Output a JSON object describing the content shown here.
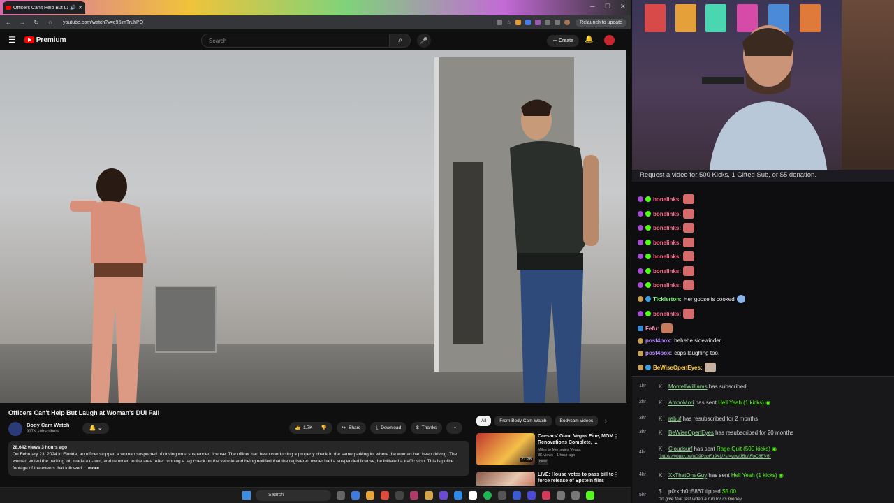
{
  "browser": {
    "tab_title": "Officers Can't Help But Lau",
    "url": "youtube.com/watch?v=e96lmTruhPQ",
    "relaunch_label": "Relaunch to update"
  },
  "youtube": {
    "logo_text": "Premium",
    "search_placeholder": "Search",
    "create_label": "Create"
  },
  "video": {
    "title": "Officers Can't Help But Laugh at Woman's DUI Fail",
    "channel": "Body Cam Watch",
    "subscribers": "917K subscribers",
    "likes": "1.7K",
    "share_label": "Share",
    "download_label": "Download",
    "thanks_label": "Thanks",
    "stats": "28,642 views  3 hours ago",
    "description": "On February 23, 2024 in Florida, an officer stopped a woman suspected of driving on a suspended license. The officer had been conducting a property check in the same parking lot where the woman had been driving. The woman exited the parking lot, made a u-turn, and returned to the area. After running a tag check on the vehicle and being notified that the registered owner had a suspended license, he initiated a traffic stop. This is police footage of the events that followed.",
    "more_label": "...more"
  },
  "chips": [
    "All",
    "From Body Cam Watch",
    "Bodycam videos"
  ],
  "recommendations": [
    {
      "title": "Caesars' Giant Vegas Fine, MGM Renovations Complete, ...",
      "channel": "Miles to Memories Vegas",
      "meta": "3K views · 1 hour ago",
      "badge": "New",
      "duration": "21:28"
    },
    {
      "title": "LIVE: House votes to pass bill to force release of Epstein files",
      "channel": "",
      "meta": "",
      "badge": "",
      "duration": ""
    }
  ],
  "taskbar": {
    "search_label": "Search"
  },
  "stream": {
    "request_banner": "Request a video for 500 Kicks, 1 Gifted Sub, or $5 donation."
  },
  "chat": [
    {
      "user": "bonelinks:",
      "text": "",
      "color": "#ff6b8a"
    },
    {
      "user": "bonelinks:",
      "text": "",
      "color": "#ff6b8a"
    },
    {
      "user": "bonelinks:",
      "text": "",
      "color": "#ff6b8a"
    },
    {
      "user": "bonelinks:",
      "text": "",
      "color": "#ff6b8a"
    },
    {
      "user": "bonelinks:",
      "text": "",
      "color": "#ff6b8a"
    },
    {
      "user": "bonelinks:",
      "text": "",
      "color": "#ff6b8a"
    },
    {
      "user": "bonelinks:",
      "text": "",
      "color": "#ff6b8a"
    },
    {
      "user": "Ticklerton:",
      "text": "Her goose is cooked",
      "color": "#7cfc7c"
    },
    {
      "user": "bonelinks:",
      "text": "",
      "color": "#ff6b8a"
    },
    {
      "user": "Fefu:",
      "text": "",
      "color": "#ff8fb8"
    },
    {
      "user": "post4pox:",
      "text": "hehehe sidewinder...",
      "color": "#b48aff"
    },
    {
      "user": "post4pox:",
      "text": "cops laughing too.",
      "color": "#b48aff"
    },
    {
      "user": "BeWiseOpenEyes:",
      "text": "",
      "color": "#ffcc33"
    }
  ],
  "events": [
    {
      "time": "1hr",
      "user": "MontellWilliams",
      "text": " has subscribed",
      "extra": "",
      "sub": ""
    },
    {
      "time": "2hr",
      "user": "AmooMori",
      "text": " has sent ",
      "extra": "Hell Yeah (1 kicks)",
      "sub": ""
    },
    {
      "time": "3hr",
      "user": "rabuf",
      "text": " has resubscribed for 2 months",
      "extra": "",
      "sub": ""
    },
    {
      "time": "3hr",
      "user": "BeWiseOpenEyes",
      "text": " has resubscribed for 20 months",
      "extra": "",
      "sub": ""
    },
    {
      "time": "4hr",
      "user": "Cloudsurf",
      "text": " has sent ",
      "extra": "Rage Quit (500 kicks)",
      "sub": "\"https://youtu.be/uD9PxqFq9KU?si=vuvtJBuitFoC8EV6\""
    },
    {
      "time": "4hr",
      "user": "XxThatOneGuy",
      "text": " has sent ",
      "extra": "Hell Yeah (1 kicks)",
      "sub": ""
    },
    {
      "time": "5hr",
      "user": "p0rkch0p5867",
      "text": " tipped ",
      "extra": "$5.00",
      "sub": "\"to give that last video a run for its money"
    }
  ]
}
